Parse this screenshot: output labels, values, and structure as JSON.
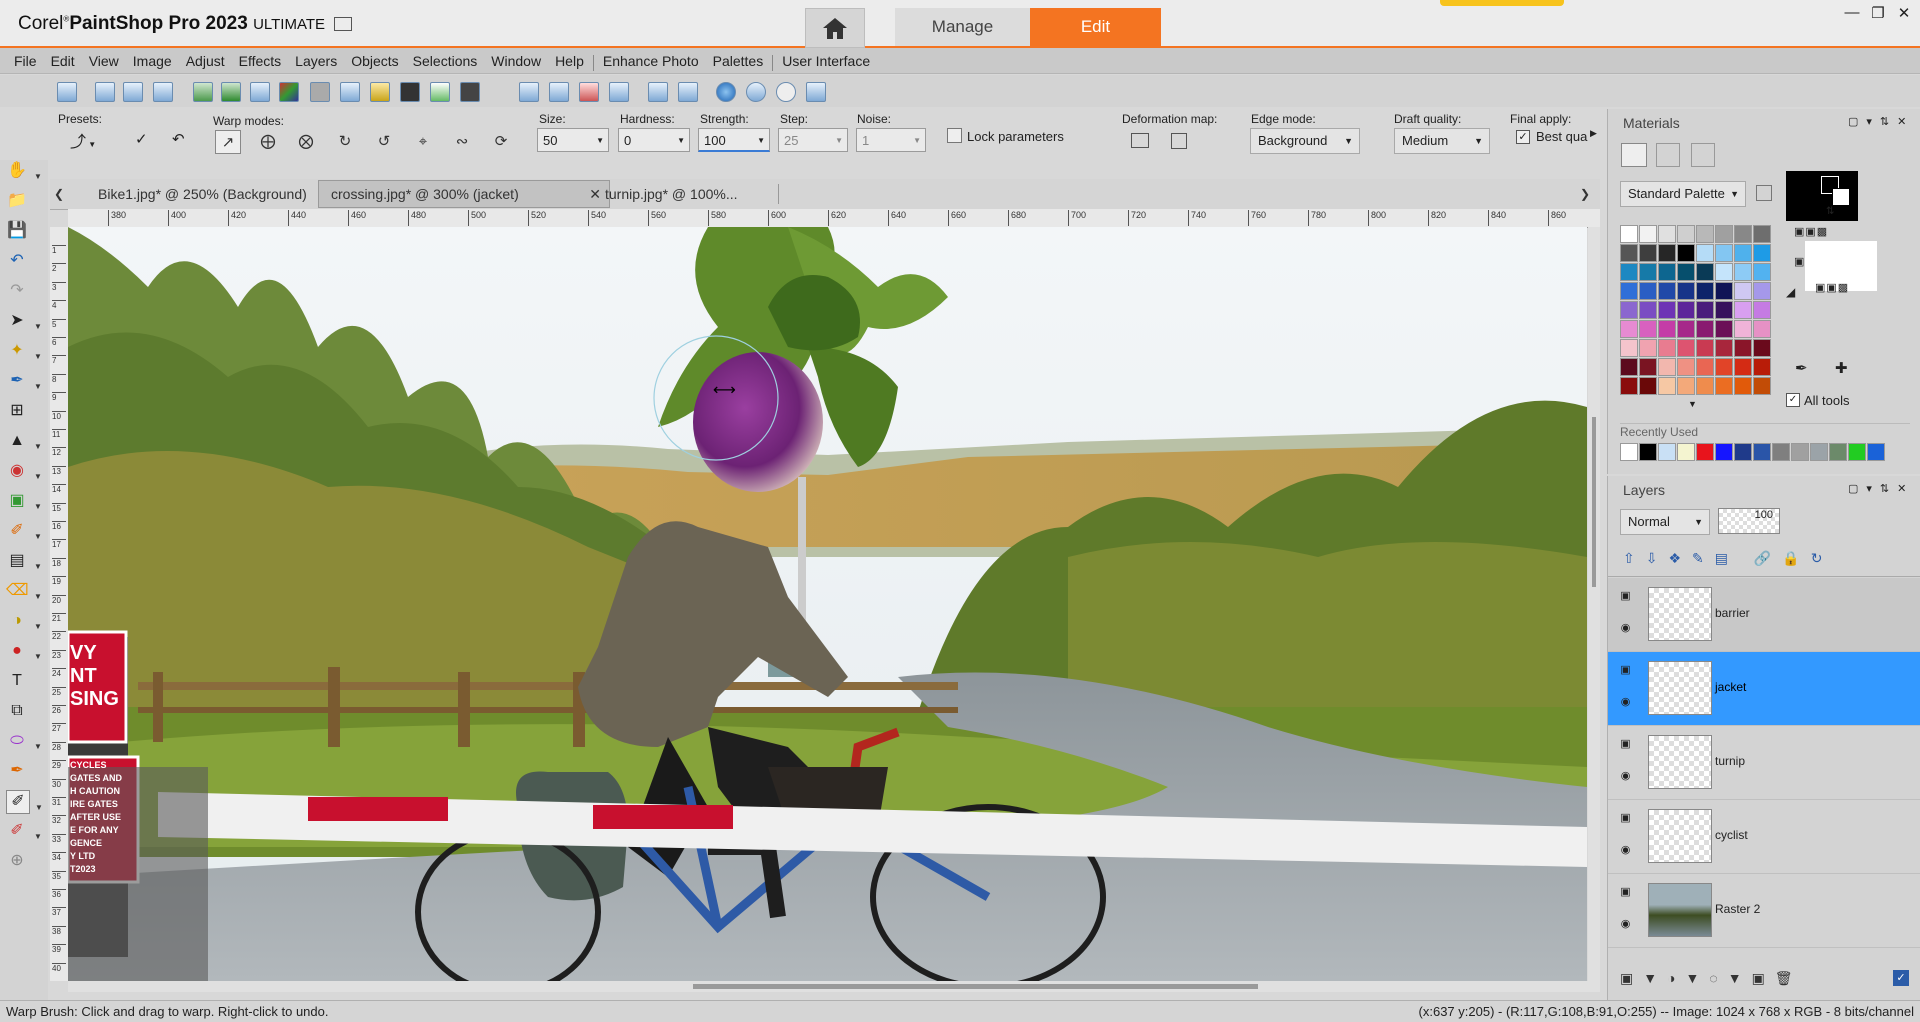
{
  "app": {
    "title_brand": "Corel",
    "title_product": "PaintShop",
    "title_pro": "Pro 2023",
    "title_edition": "ULTIMATE",
    "tabs": {
      "manage": "Manage",
      "edit": "Edit"
    },
    "accent_color": "#f47421"
  },
  "menu": [
    "File",
    "Edit",
    "View",
    "Image",
    "Adjust",
    "Effects",
    "Layers",
    "Objects",
    "Selections",
    "Window",
    "Help",
    "Enhance Photo",
    "Palettes",
    "User Interface"
  ],
  "tool_options": {
    "presets_label": "Presets:",
    "warp_modes_label": "Warp modes:",
    "size_label": "Size:",
    "size_value": "50",
    "hardness_label": "Hardness:",
    "hardness_value": "0",
    "strength_label": "Strength:",
    "strength_value": "100",
    "step_label": "Step:",
    "step_value": "25",
    "noise_label": "Noise:",
    "noise_value": "1",
    "lock_label": "Lock parameters",
    "deformation_label": "Deformation map:",
    "edge_mode_label": "Edge mode:",
    "edge_mode_value": "Background",
    "draft_quality_label": "Draft quality:",
    "draft_quality_value": "Medium",
    "final_apply_label": "Final apply:",
    "final_apply_value": "Best qua"
  },
  "doc_tabs": [
    {
      "label": "Bike1.jpg* @ 250% (Background)",
      "active": false
    },
    {
      "label": "crossing.jpg* @ 300% (jacket)",
      "active": true
    },
    {
      "label": "turnip.jpg* @ 100%...",
      "active": false
    }
  ],
  "ruler_labels": [
    "380",
    "400",
    "420",
    "440",
    "460",
    "480",
    "500",
    "520",
    "540",
    "560",
    "580",
    "600",
    "620",
    "640",
    "660",
    "680",
    "700",
    "720",
    "740",
    "760",
    "780",
    "800",
    "820",
    "840",
    "860"
  ],
  "ruler_labels_v": [
    "1",
    "2",
    "3",
    "4",
    "5",
    "6",
    "7",
    "8",
    "9",
    "10",
    "11",
    "12",
    "13",
    "14",
    "15",
    "16",
    "17",
    "18",
    "19",
    "20",
    "21",
    "22",
    "23",
    "24",
    "25",
    "26",
    "27",
    "28",
    "29",
    "30",
    "31",
    "32",
    "33",
    "34",
    "35",
    "36",
    "37",
    "38",
    "39",
    "40"
  ],
  "canvas_sign": {
    "lines_top": [
      "VY",
      "NT",
      "SING"
    ],
    "lines_bottom": [
      "CYCLES",
      "GATES AND",
      "H CAUTION",
      "IRE GATES",
      "AFTER USE",
      "E FOR ANY",
      "GENCE",
      "Y LTD",
      "T2023"
    ]
  },
  "materials": {
    "title": "Materials",
    "palette_dropdown": "Standard Palette",
    "recently_used_label": "Recently Used",
    "all_tools_label": "All tools",
    "foreground_color": "#000000",
    "background_color": "#ffffff",
    "swatches": [
      "#ffffff",
      "#f2f2f2",
      "#e0e0e0",
      "#cfcfcf",
      "#b8b8b8",
      "#a0a0a0",
      "#888888",
      "#6e6e6e",
      "#565656",
      "#3e3e3e",
      "#262626",
      "#000000",
      "#b5dcf7",
      "#83c6f2",
      "#4fb1ec",
      "#1e9be6",
      "#1d88c2",
      "#167aa8",
      "#0d6690",
      "#064f6d",
      "#0a3a56",
      "#c5e4fb",
      "#8dcbf5",
      "#52b2f0",
      "#2f6fd8",
      "#2a5ec4",
      "#2149a8",
      "#173489",
      "#0d236a",
      "#101456",
      "#cfc8f3",
      "#a598ea",
      "#8b67cf",
      "#7a4dc3",
      "#6e33b5",
      "#5d259a",
      "#4a1b7c",
      "#37115d",
      "#d89ff0",
      "#c57be3",
      "#e68bd2",
      "#d861bf",
      "#c43da7",
      "#a6288a",
      "#891a70",
      "#6b0f57",
      "#f0b3d8",
      "#e691c5",
      "#f4c4cc",
      "#f0a3b0",
      "#e87c90",
      "#dd5470",
      "#c93a52",
      "#a8263c",
      "#8a1529",
      "#6a0a1c",
      "#5c0b1e",
      "#7a1422",
      "#f2b7ae",
      "#ef9183",
      "#e96653",
      "#e14428",
      "#d42b14",
      "#b81c08",
      "#8a0c0c",
      "#6a0808",
      "#f6c8a4",
      "#f3a97a",
      "#ef8c4d",
      "#eb6d22",
      "#e15a0a",
      "#c24c06"
    ],
    "recent": [
      "#ffffff",
      "#000000",
      "#c9e0f5",
      "#f4f4d0",
      "#e8141c",
      "#1515ff",
      "#1f3a8a",
      "#2a55a8",
      "#7f7f7f",
      "#a0a0a0",
      "#9ba3a8",
      "#6c8a6a",
      "#22cc22",
      "#1a62d8"
    ]
  },
  "layers": {
    "title": "Layers",
    "blend_mode": "Normal",
    "opacity": "100",
    "items": [
      {
        "name": "barrier",
        "selected": false
      },
      {
        "name": "jacket",
        "selected": true
      },
      {
        "name": "turnip",
        "selected": false
      },
      {
        "name": "cyclist",
        "selected": false
      },
      {
        "name": "Raster 2",
        "selected": false
      }
    ]
  },
  "status": {
    "left": "Warp Brush: Click and drag to warp. Right-click to undo.",
    "right": "(x:637 y:205) - (R:117,G:108,B:91,O:255) -- Image:  1024 x 768 x RGB - 8 bits/channel"
  }
}
